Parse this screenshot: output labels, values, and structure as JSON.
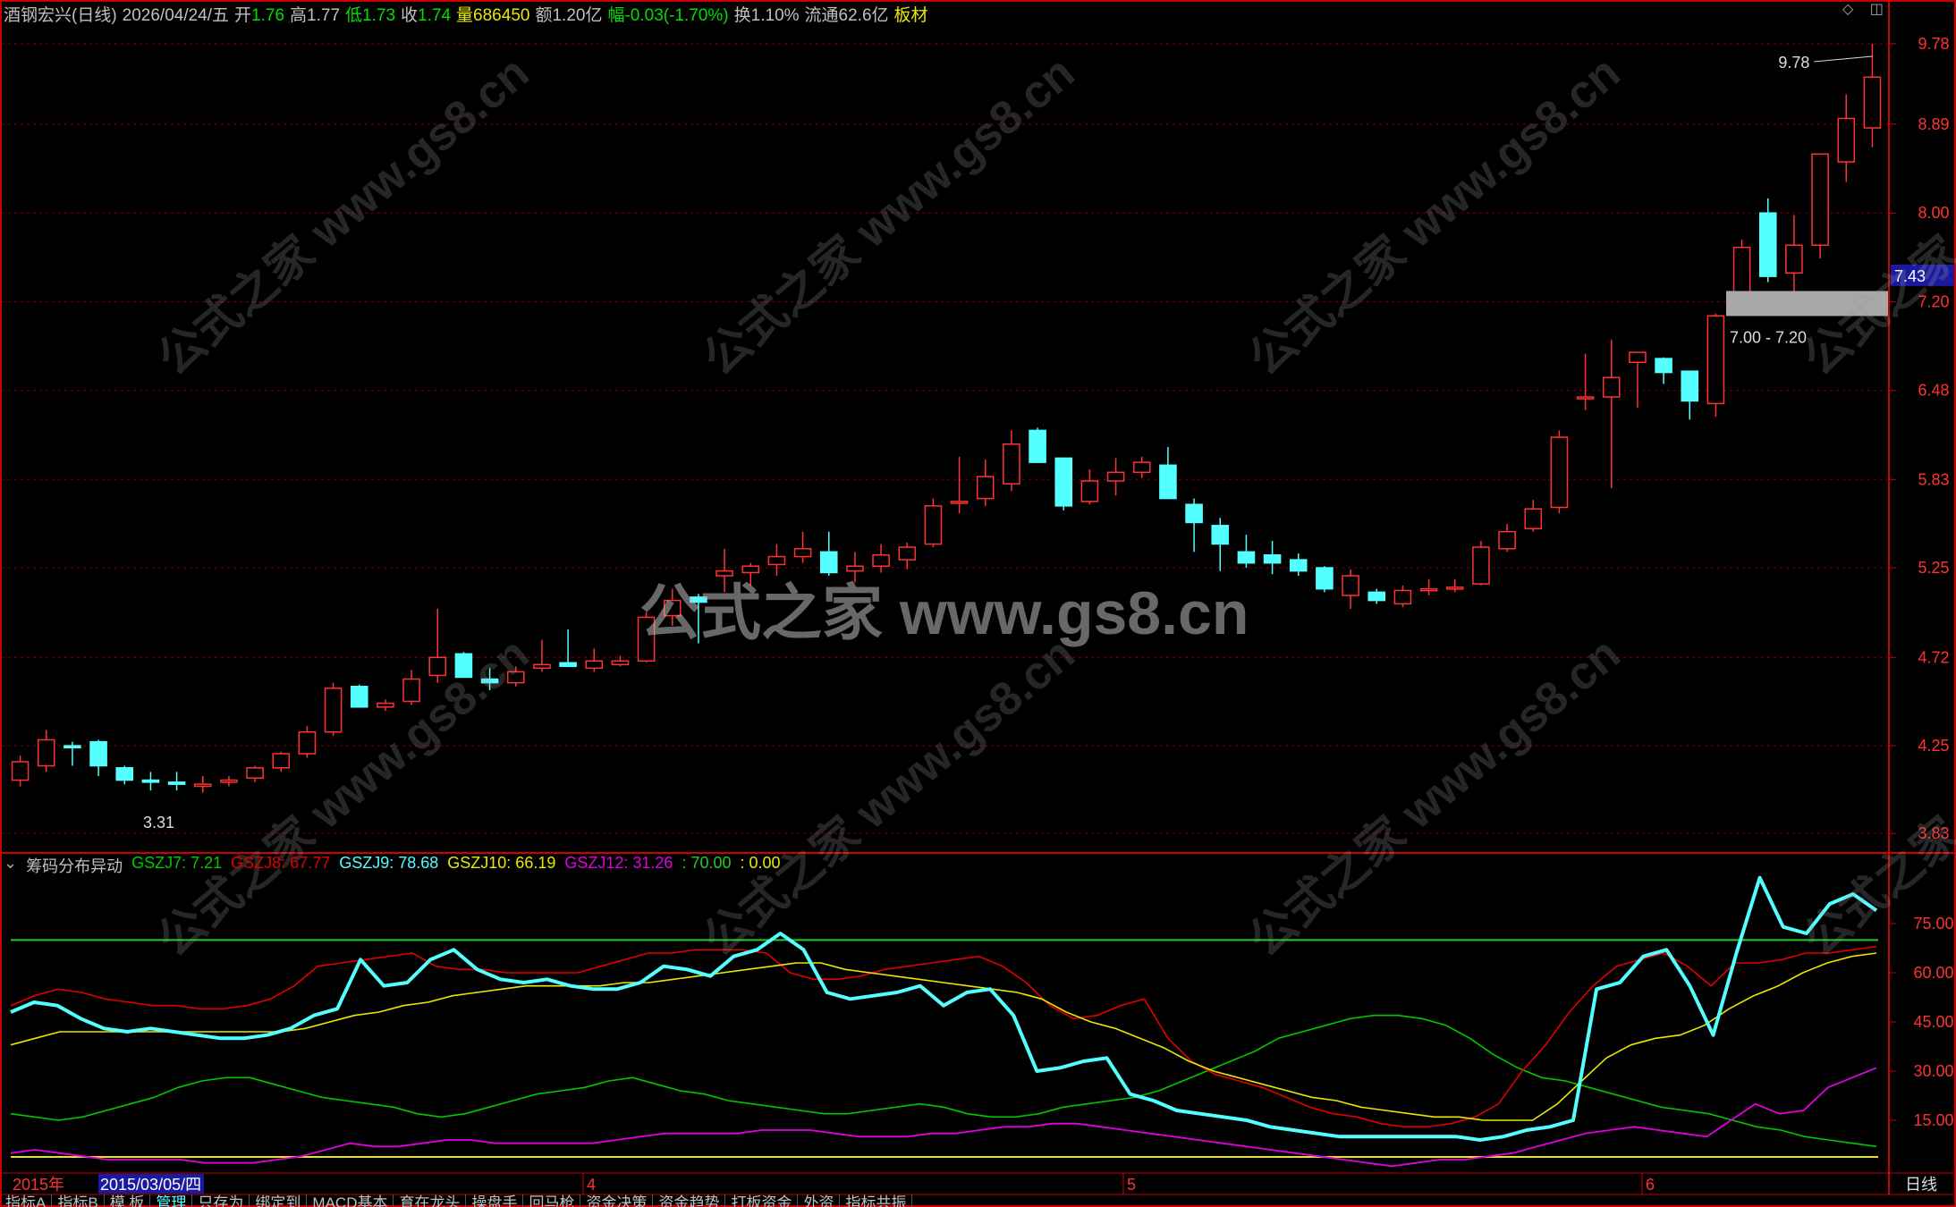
{
  "header": {
    "title": "酒钢宏兴(日线)",
    "date": "2026/04/24/五",
    "open_label": "开",
    "open": "1.76",
    "high_label": "高",
    "high": "1.77",
    "low_label": "低",
    "low": "1.73",
    "close_label": "收",
    "close": "1.74",
    "vol_label": "量",
    "vol": "686450",
    "amt_label": "额",
    "amt": "1.20亿",
    "chg_label": "幅",
    "chg": "-0.03(-1.70%)",
    "turn_label": "换",
    "turn": "1.10%",
    "float_label": "流通",
    "float": "62.6亿",
    "sector": "板材"
  },
  "colors": {
    "bg": "#000000",
    "up": "#ff3232",
    "down": "#54ffff",
    "grid": "#7a0000",
    "axis": "#cc0000",
    "gszj7": "#00c800",
    "gszj8": "#e00000",
    "gszj9": "#54ffff",
    "gszj10": "#e8e800",
    "gszj12": "#e000e0",
    "line70": "#22cc22",
    "line0": "#e8e800",
    "price_tag": "#1a1aa0",
    "zone": "#a8a8a8"
  },
  "price_axis": {
    "ticks": [
      "9.78",
      "8.89",
      "8.00",
      "7.20",
      "6.48",
      "5.83",
      "5.25",
      "4.72",
      "4.25",
      "3.83"
    ],
    "current": "7.43"
  },
  "annotations": {
    "high_label": "9.78",
    "low_label": "3.31",
    "zone_label": "7.00 - 7.20"
  },
  "indicator": {
    "name": "筹码分布异动",
    "labels": [
      {
        "text": "GSZJ7: 7.21",
        "color": "#00c800"
      },
      {
        "text": "GSZJ8: 67.77",
        "color": "#e00000"
      },
      {
        "text": "GSZJ9: 78.68",
        "color": "#54ffff"
      },
      {
        "text": "GSZJ10: 66.19",
        "color": "#e8e800"
      },
      {
        "text": "GSZJ12: 31.26",
        "color": "#e000e0"
      },
      {
        "text": ": 70.00",
        "color": "#22cc22"
      },
      {
        "text": ": 0.00",
        "color": "#e8e800"
      }
    ],
    "ticks": [
      "75.00",
      "60.00",
      "45.00",
      "30.00",
      "15.00"
    ]
  },
  "date_axis": {
    "year": "2015年",
    "cursor": "2015/03/05/四",
    "months": [
      "4",
      "5",
      "6"
    ],
    "period": "日线"
  },
  "tabs": [
    "指标A",
    "指标B",
    "模 板",
    "管理",
    "只存为",
    "绑定到",
    "MACD基本",
    "育在龙头",
    "操盘手",
    "回马枪",
    "资金决策",
    "资金趋势",
    "打板资金",
    "外资",
    "指标共振"
  ],
  "active_tab": "管理",
  "watermark": {
    "main": "公式之家 www.gs8.cn",
    "small": "公式之家 www.gs8.cn"
  },
  "chart_data": [
    {
      "type": "candlestick",
      "title": "酒钢宏兴(日线)",
      "y_ticks": [
        3.83,
        4.25,
        4.72,
        5.25,
        5.83,
        6.48,
        7.2,
        8.0,
        8.89,
        9.78
      ],
      "ylim": [
        3.75,
        10.0
      ],
      "annotated_high": 9.78,
      "annotated_low": 3.31,
      "zone": [
        7.0,
        7.2
      ],
      "ohlc": [
        [
          4.08,
          4.2,
          4.05,
          4.17
        ],
        [
          4.15,
          4.33,
          4.12,
          4.28
        ],
        [
          4.25,
          4.27,
          4.15,
          4.24
        ],
        [
          4.27,
          4.28,
          4.1,
          4.15
        ],
        [
          4.14,
          4.15,
          4.06,
          4.08
        ],
        [
          4.08,
          4.12,
          4.03,
          4.07
        ],
        [
          4.07,
          4.12,
          4.03,
          4.06
        ],
        [
          4.05,
          4.1,
          4.02,
          4.06
        ],
        [
          4.07,
          4.1,
          4.05,
          4.08
        ],
        [
          4.09,
          4.15,
          4.07,
          4.14
        ],
        [
          4.14,
          4.22,
          4.12,
          4.21
        ],
        [
          4.21,
          4.35,
          4.19,
          4.32
        ],
        [
          4.32,
          4.58,
          4.3,
          4.55
        ],
        [
          4.56,
          4.57,
          4.45,
          4.45
        ],
        [
          4.45,
          4.49,
          4.43,
          4.47
        ],
        [
          4.48,
          4.65,
          4.46,
          4.6
        ],
        [
          4.62,
          5.0,
          4.58,
          4.72
        ],
        [
          4.74,
          4.75,
          4.61,
          4.61
        ],
        [
          4.6,
          4.66,
          4.54,
          4.58
        ],
        [
          4.58,
          4.67,
          4.56,
          4.64
        ],
        [
          4.66,
          4.82,
          4.64,
          4.68
        ],
        [
          4.69,
          4.88,
          4.68,
          4.67
        ],
        [
          4.66,
          4.77,
          4.64,
          4.7
        ],
        [
          4.68,
          4.73,
          4.67,
          4.7
        ],
        [
          4.7,
          4.98,
          4.69,
          4.95
        ],
        [
          4.96,
          5.12,
          4.9,
          5.05
        ],
        [
          5.07,
          5.09,
          4.8,
          5.04
        ],
        [
          5.2,
          5.37,
          5.1,
          5.23
        ],
        [
          5.22,
          5.28,
          5.14,
          5.26
        ],
        [
          5.27,
          5.4,
          5.2,
          5.32
        ],
        [
          5.32,
          5.48,
          5.28,
          5.37
        ],
        [
          5.35,
          5.48,
          5.2,
          5.22
        ],
        [
          5.23,
          5.35,
          5.16,
          5.26
        ],
        [
          5.26,
          5.4,
          5.22,
          5.33
        ],
        [
          5.3,
          5.41,
          5.24,
          5.38
        ],
        [
          5.4,
          5.7,
          5.38,
          5.65
        ],
        [
          5.67,
          5.99,
          5.6,
          5.68
        ],
        [
          5.7,
          5.97,
          5.65,
          5.85
        ],
        [
          5.8,
          6.18,
          5.75,
          6.08
        ],
        [
          6.18,
          6.2,
          5.95,
          5.95
        ],
        [
          5.98,
          5.98,
          5.62,
          5.65
        ],
        [
          5.68,
          5.9,
          5.66,
          5.82
        ],
        [
          5.82,
          5.98,
          5.72,
          5.88
        ],
        [
          5.88,
          5.99,
          5.84,
          5.95
        ],
        [
          5.93,
          6.06,
          5.7,
          5.7
        ],
        [
          5.66,
          5.7,
          5.35,
          5.54
        ],
        [
          5.52,
          5.57,
          5.23,
          5.4
        ],
        [
          5.35,
          5.46,
          5.25,
          5.28
        ],
        [
          5.33,
          5.42,
          5.21,
          5.28
        ],
        [
          5.3,
          5.34,
          5.2,
          5.23
        ],
        [
          5.25,
          5.26,
          5.1,
          5.12
        ],
        [
          5.08,
          5.24,
          5.0,
          5.2
        ],
        [
          5.1,
          5.12,
          5.03,
          5.05
        ],
        [
          5.03,
          5.14,
          5.01,
          5.11
        ],
        [
          5.11,
          5.18,
          5.08,
          5.12
        ],
        [
          5.12,
          5.18,
          5.1,
          5.13
        ],
        [
          5.15,
          5.42,
          5.14,
          5.38
        ],
        [
          5.37,
          5.53,
          5.35,
          5.48
        ],
        [
          5.5,
          5.69,
          5.48,
          5.63
        ],
        [
          5.64,
          6.18,
          5.6,
          6.13
        ],
        [
          6.42,
          6.77,
          6.33,
          6.43
        ],
        [
          6.43,
          6.88,
          5.77,
          6.58
        ],
        [
          6.7,
          6.78,
          6.35,
          6.78
        ],
        [
          6.73,
          6.74,
          6.53,
          6.62
        ],
        [
          6.63,
          6.63,
          6.26,
          6.4
        ],
        [
          6.38,
          7.1,
          6.28,
          7.08
        ],
        [
          7.28,
          7.75,
          7.18,
          7.68
        ],
        [
          8.0,
          8.14,
          7.37,
          7.42
        ],
        [
          7.45,
          7.98,
          7.28,
          7.7
        ],
        [
          7.7,
          8.51,
          7.58,
          8.58
        ],
        [
          8.5,
          9.21,
          8.3,
          8.95
        ],
        [
          8.85,
          9.78,
          8.65,
          9.4
        ]
      ]
    },
    {
      "type": "line",
      "title": "筹码分布异动",
      "ylim": [
        0,
        90
      ],
      "reference_lines": [
        70,
        0
      ],
      "series": [
        {
          "name": "GSZJ7",
          "values": [
            17,
            16,
            15,
            16,
            18,
            20,
            22,
            25,
            27,
            28,
            28,
            26,
            24,
            22,
            21,
            20,
            19,
            17,
            16,
            17,
            19,
            21,
            23,
            24,
            25,
            27,
            28,
            26,
            24,
            23,
            21,
            20,
            19,
            18,
            17,
            17,
            18,
            19,
            20,
            19,
            17,
            16,
            16,
            17,
            19,
            20,
            21,
            22,
            24,
            27,
            30,
            33,
            36,
            40,
            42,
            44,
            46,
            47,
            47,
            46,
            44,
            40,
            35,
            31,
            28,
            27,
            25,
            23,
            21,
            19,
            18,
            17,
            15,
            13,
            12,
            10,
            9,
            8,
            7
          ]
        },
        {
          "name": "GSZJ8",
          "values": [
            50,
            53,
            55,
            54,
            52,
            51,
            50,
            50,
            49,
            49,
            50,
            52,
            56,
            62,
            63,
            64,
            65,
            66,
            62,
            61,
            61,
            60,
            60,
            60,
            60,
            62,
            64,
            66,
            66,
            67,
            67,
            67,
            66,
            60,
            58,
            58,
            59,
            61,
            62,
            63,
            64,
            65,
            62,
            57,
            50,
            46,
            47,
            50,
            52,
            40,
            33,
            29,
            27,
            25,
            22,
            19,
            17,
            16,
            14,
            13,
            13,
            14,
            16,
            20,
            30,
            38,
            48,
            56,
            62,
            64,
            66,
            62,
            56,
            63,
            63,
            64,
            66,
            66,
            67,
            68
          ]
        },
        {
          "name": "GSZJ9",
          "values": [
            48,
            51,
            50,
            46,
            43,
            42,
            43,
            42,
            41,
            40,
            40,
            41,
            43,
            47,
            49,
            64,
            56,
            57,
            64,
            67,
            61,
            58,
            57,
            58,
            56,
            55,
            55,
            57,
            62,
            61,
            59,
            65,
            67,
            72,
            67,
            54,
            52,
            53,
            54,
            56,
            50,
            54,
            55,
            47,
            30,
            31,
            33,
            34,
            23,
            21,
            18,
            17,
            16,
            15,
            13,
            12,
            11,
            10,
            10,
            10,
            10,
            10,
            10,
            9,
            10,
            12,
            13,
            15,
            55,
            57,
            65,
            67,
            56,
            41,
            66,
            89,
            74,
            72,
            81,
            84,
            79
          ]
        },
        {
          "name": "GSZJ10",
          "values": [
            38,
            40,
            42,
            42,
            42,
            42,
            42,
            42,
            42,
            42,
            42,
            42,
            43,
            45,
            47,
            48,
            50,
            51,
            53,
            54,
            55,
            56,
            56,
            56,
            56,
            57,
            57,
            58,
            59,
            60,
            61,
            62,
            63,
            63,
            61,
            60,
            59,
            58,
            57,
            56,
            55,
            54,
            52,
            48,
            45,
            43,
            40,
            37,
            33,
            30,
            28,
            26,
            24,
            22,
            21,
            19,
            18,
            17,
            16,
            16,
            15,
            15,
            15,
            20,
            27,
            34,
            38,
            40,
            41,
            44,
            49,
            53,
            56,
            60,
            63,
            65,
            66
          ]
        },
        {
          "name": "GSZJ12",
          "values": [
            5,
            6,
            5,
            4,
            3,
            3,
            3,
            3,
            2,
            2,
            2,
            3,
            4,
            6,
            8,
            7,
            7,
            8,
            9,
            9,
            8,
            8,
            8,
            8,
            8,
            9,
            10,
            11,
            11,
            11,
            11,
            12,
            12,
            12,
            11,
            10,
            10,
            10,
            11,
            11,
            12,
            13,
            13,
            14,
            14,
            13,
            12,
            11,
            10,
            9,
            8,
            7,
            6,
            5,
            4,
            3,
            2,
            1,
            2,
            3,
            3,
            4,
            5,
            7,
            9,
            11,
            12,
            13,
            12,
            11,
            10,
            15,
            20,
            17,
            18,
            25,
            28,
            31
          ]
        },
        {
          "name": "",
          "values": [
            70
          ]
        },
        {
          "name": "",
          "values": [
            0
          ]
        }
      ]
    }
  ]
}
